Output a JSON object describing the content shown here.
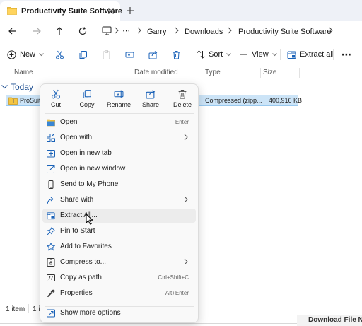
{
  "window": {
    "tab_title": "Productivity Suite Software"
  },
  "address": {
    "more": "⋯",
    "crumbs": [
      "Garry",
      "Downloads",
      "Productivity Suite Software"
    ]
  },
  "commands": {
    "new_label": "New",
    "sort_label": "Sort",
    "view_label": "View",
    "extract_all_label": "Extract all",
    "more_label": "⋯"
  },
  "columns": {
    "name": "Name",
    "date_modified": "Date modified",
    "type": "Type",
    "size": "Size"
  },
  "group": {
    "label": "Today"
  },
  "file": {
    "name": "ProSuite",
    "type": "Compressed (zipp...",
    "size": "400,916 KB"
  },
  "context_menu": {
    "top_actions": [
      {
        "label": "Cut",
        "icon": "scissors-icon"
      },
      {
        "label": "Copy",
        "icon": "copy-icon"
      },
      {
        "label": "Rename",
        "icon": "rename-icon"
      },
      {
        "label": "Share",
        "icon": "share-icon"
      },
      {
        "label": "Delete",
        "icon": "trash-icon"
      }
    ],
    "items": [
      {
        "label": "Open",
        "shortcut": "Enter",
        "icon": "open-folder-icon"
      },
      {
        "label": "Open with",
        "icon": "open-with-icon",
        "submenu": true
      },
      {
        "label": "Open in new tab",
        "icon": "new-tab-icon"
      },
      {
        "label": "Open in new window",
        "icon": "new-window-icon"
      },
      {
        "label": "Send to My Phone",
        "icon": "phone-icon"
      },
      {
        "label": "Share with",
        "icon": "share-with-icon",
        "submenu": true
      },
      {
        "label": "Extract All...",
        "icon": "extract-icon",
        "hover": true
      },
      {
        "label": "Pin to Start",
        "icon": "pin-icon"
      },
      {
        "label": "Add to Favorites",
        "icon": "star-icon"
      },
      {
        "label": "Compress to...",
        "icon": "zip-icon",
        "submenu": true
      },
      {
        "label": "Copy as path",
        "shortcut": "Ctrl+Shift+C",
        "icon": "path-icon"
      },
      {
        "label": "Properties",
        "shortcut": "Alt+Enter",
        "icon": "wrench-icon"
      },
      {
        "label": "Show more options",
        "icon": "more-options-icon"
      }
    ]
  },
  "status": {
    "item_count": "1 item",
    "selected_prefix": "1 i"
  },
  "download_bar": {
    "text": "Download File Na"
  },
  "colors": {
    "accent": "#0067c0",
    "selection": "#cce4f7",
    "folder": "#f4c542"
  }
}
